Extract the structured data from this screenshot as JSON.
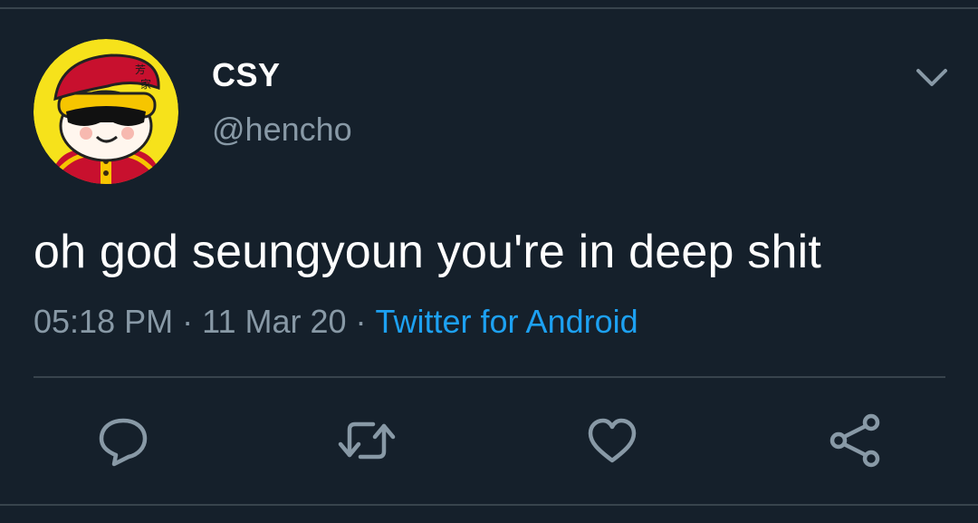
{
  "tweet": {
    "author": {
      "display_name": "CSY",
      "handle": "@hencho"
    },
    "text": "oh god seungyoun you're in deep shit",
    "time": "05:18 PM",
    "separator": "·",
    "date": "11 Mar 20",
    "source": "Twitter for Android"
  },
  "actions": {
    "icons": [
      "reply-icon",
      "retweet-icon",
      "like-icon",
      "share-icon"
    ]
  },
  "colors": {
    "background": "#15202b",
    "divider": "#38444d",
    "primary_text": "#ffffff",
    "secondary_text": "#8899a6",
    "accent": "#1da1f2",
    "icon": "#8899a6"
  }
}
